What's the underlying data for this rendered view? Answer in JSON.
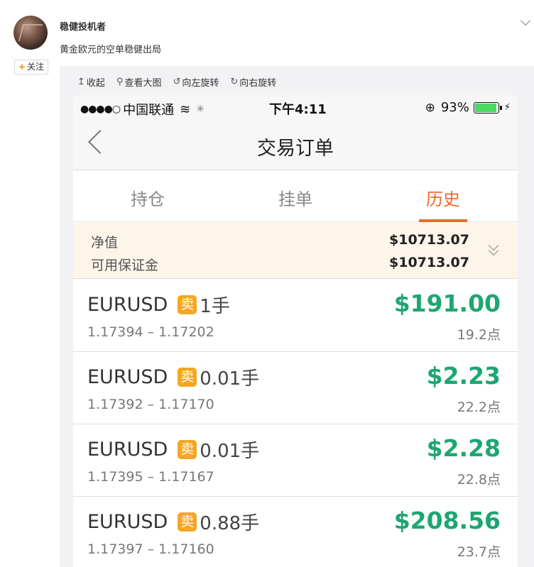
{
  "post": {
    "username": "稳健投机者",
    "text": "黄金欧元的空单稳健出局",
    "follow_label": "关注",
    "follow_plus": "+"
  },
  "toolbar": {
    "items": [
      {
        "icon": "collapse-icon",
        "glyph": "↥",
        "label": "收起"
      },
      {
        "icon": "zoom-icon",
        "glyph": "⚲",
        "label": "查看大图"
      },
      {
        "icon": "rotate-left-icon",
        "glyph": "↺",
        "label": "向左旋转"
      },
      {
        "icon": "rotate-right-icon",
        "glyph": "↻",
        "label": "向右旋转"
      }
    ]
  },
  "phone": {
    "status": {
      "signal": "●●●●○",
      "carrier": "中国联通",
      "wifi": "≋",
      "loading": "✳",
      "time": "下午4:11",
      "lock_icon": "⊕",
      "battery": "93%",
      "battery_level_percent": 93,
      "charge": "⚡"
    },
    "nav": {
      "title": "交易订单"
    },
    "tabs": [
      "持仓",
      "挂单",
      "历史"
    ],
    "active_tab": "历史",
    "summary": {
      "equity_label": "净值",
      "equity_value": "$10713.07",
      "margin_label": "可用保证金",
      "margin_value": "$10713.07"
    },
    "orders": [
      {
        "symbol": "EURUSD",
        "side": "卖",
        "lot": "1手",
        "profit": "$191.00",
        "range": "1.17394 – 1.17202",
        "points": "19.2点"
      },
      {
        "symbol": "EURUSD",
        "side": "卖",
        "lot": "0.01手",
        "profit": "$2.23",
        "range": "1.17392 – 1.17170",
        "points": "22.2点"
      },
      {
        "symbol": "EURUSD",
        "side": "卖",
        "lot": "0.01手",
        "profit": "$2.28",
        "range": "1.17395 – 1.17167",
        "points": "22.8点"
      },
      {
        "symbol": "EURUSD",
        "side": "卖",
        "lot": "0.88手",
        "profit": "$208.56",
        "range": "1.17397 – 1.17160",
        "points": "23.7点"
      }
    ]
  },
  "colors": {
    "accent_orange": "#f0692b",
    "profit_green": "#1ea672",
    "sell_badge": "#f5a623"
  }
}
